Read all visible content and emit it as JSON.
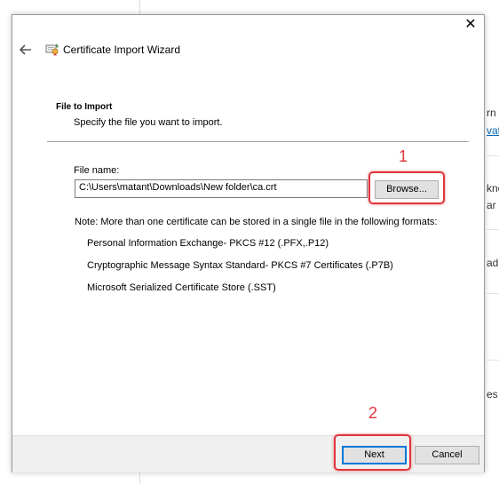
{
  "background": {
    "fragments": [
      "rn",
      "vat",
      "kne",
      "ar",
      "ad",
      "es"
    ]
  },
  "dialog": {
    "close_glyph": "✕",
    "title": "Certificate Import Wizard",
    "header": {
      "title": "File to Import",
      "subtitle": "Specify the file you want to import."
    },
    "file": {
      "label": "File name:",
      "value": "C:\\Users\\matant\\Downloads\\New folder\\ca.crt",
      "browse_label": "Browse..."
    },
    "note": "Note:  More than one certificate can be stored in a single file in the following formats:",
    "formats": [
      "Personal Information Exchange- PKCS #12 (.PFX,.P12)",
      "Cryptographic Message Syntax Standard- PKCS #7 Certificates (.P7B)",
      "Microsoft Serialized Certificate Store (.SST)"
    ],
    "buttons": {
      "next": "Next",
      "cancel": "Cancel"
    }
  },
  "annotations": {
    "step1": "1",
    "step2": "2",
    "color": "#e0353b"
  }
}
